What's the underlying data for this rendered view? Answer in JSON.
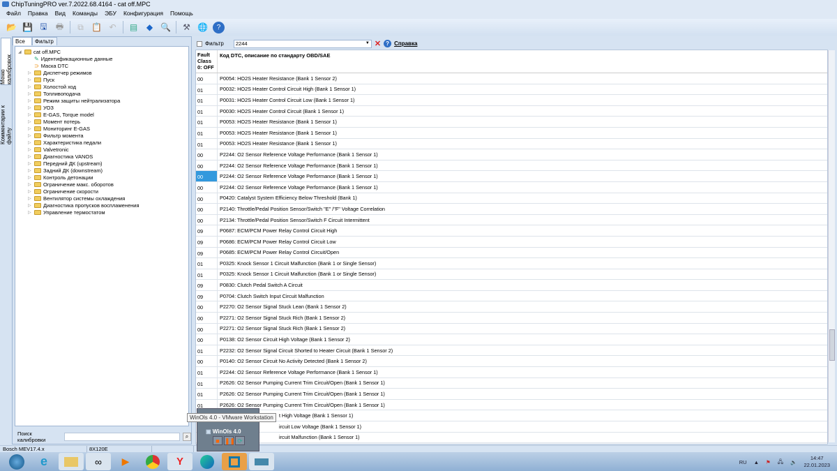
{
  "window": {
    "title": "ChipTuningPRO ver.7.2022.68.4164 - cat off.MPC"
  },
  "menu": [
    "Файл",
    "Правка",
    "Вид",
    "Команды",
    "ЭБУ",
    "Конфигурация",
    "Помощь"
  ],
  "vertical_tabs": [
    "Меню калибровок",
    "Комментарии к файлу"
  ],
  "left_tabs": [
    "Все",
    "Фильтр"
  ],
  "tree": {
    "root": "cat off.MPC",
    "items": [
      "Идентификационные данные",
      "Маска DTC",
      "Диспетчер режимов",
      "Пуск",
      "Холостой ход",
      "Топливоподача",
      "Режим защиты нейтрализатора",
      "УОЗ",
      "E-GAS, Torque model",
      "Момент потерь",
      "Мониторинг E-GAS",
      "Фильтр момента",
      "Характеристика педали",
      "Valvetronic",
      "Диагностика VANOS",
      "Передний ДК (upstream)",
      "Задний ДК (downstream)",
      "Контроль детонации",
      "Ограничение макс. оборотов",
      "Ограничение скорости",
      "Вентилятор системы охлаждения",
      "Диагностика пропусков воспламенения",
      "Управление термостатом"
    ]
  },
  "search": {
    "label": "Поиск калибровки",
    "value": ""
  },
  "filter": {
    "label": "Фильтр",
    "value": "2244",
    "help": "Справка"
  },
  "grid": {
    "col1": "Fault Class 0: OFF",
    "col2": "Код DTC, описание по стандарту OBD/SAE",
    "rows": [
      [
        "00",
        "P0054: HO2S Heater Resistance (Bank 1 Sensor 2)"
      ],
      [
        "01",
        "P0032: HO2S Heater Control Circuit High (Bank 1 Sensor 1)"
      ],
      [
        "01",
        "P0031: HO2S Heater Control Circuit Low (Bank 1 Sensor 1)"
      ],
      [
        "01",
        "P0030: HO2S Heater Control Circuit (Bank 1 Sensor 1)"
      ],
      [
        "01",
        "P0053: HO2S Heater Resistance (Bank 1 Sensor 1)"
      ],
      [
        "01",
        "P0053: HO2S Heater Resistance (Bank 1 Sensor 1)"
      ],
      [
        "01",
        "P0053: HO2S Heater Resistance (Bank 1 Sensor 1)"
      ],
      [
        "00",
        "P2244: O2 Sensor Reference Voltage Performance (Bank 1 Sensor 1)"
      ],
      [
        "00",
        "P2244: O2 Sensor Reference Voltage Performance (Bank 1 Sensor 1)"
      ],
      [
        "00",
        "P2244: O2 Sensor Reference Voltage Performance (Bank 1 Sensor 1)"
      ],
      [
        "00",
        "P2244: O2 Sensor Reference Voltage Performance (Bank 1 Sensor 1)"
      ],
      [
        "00",
        "P0420: Catalyst System Efficiency Below Threshold (Bank 1)"
      ],
      [
        "00",
        "P2140: Throttle/Pedal Position Sensor/Switch \"E\" /\"F\" Voltage Correlation"
      ],
      [
        "00",
        "P2134: Throttle/Pedal Position Sensor/Switch F Circuit Intermittent"
      ],
      [
        "09",
        "P0687: ECM/PCM Power Relay Control Circuit High"
      ],
      [
        "09",
        "P0686: ECM/PCM Power Relay Control Circuit Low"
      ],
      [
        "09",
        "P0685: ECM/PCM Power Relay Control Circuit/Open"
      ],
      [
        "01",
        "P0325: Knock Sensor 1 Circuit Malfunction (Bank 1 or Single Sensor)"
      ],
      [
        "01",
        "P0325: Knock Sensor 1 Circuit Malfunction (Bank 1 or Single Sensor)"
      ],
      [
        "09",
        "P0830: Clutch Pedal Switch A Circuit"
      ],
      [
        "09",
        "P0704: Clutch Switch Input Circuit Malfunction"
      ],
      [
        "00",
        "P2270: O2 Sensor Signal Stuck Lean (Bank 1 Sensor 2)"
      ],
      [
        "00",
        "P2271: O2 Sensor Signal Stuck Rich (Bank 1 Sensor 2)"
      ],
      [
        "00",
        "P2271: O2 Sensor Signal Stuck Rich (Bank 1 Sensor 2)"
      ],
      [
        "00",
        "P0138: O2 Sensor Circuit High Voltage (Bank 1 Sensor 2)"
      ],
      [
        "01",
        "P2232: O2 Sensor Signal Circuit Shorted to Heater Circuit (Bank 1 Sensor 2)"
      ],
      [
        "00",
        "P0140: O2 Sensor Circuit No Activity Detected (Bank 1 Sensor 2)"
      ],
      [
        "01",
        "P2244: O2 Sensor Reference Voltage Performance (Bank 1 Sensor 1)"
      ],
      [
        "01",
        "P2626: O2 Sensor Pumping Current Trim Circuit/Open (Bank 1 Sensor 1)"
      ],
      [
        "01",
        "P2626: O2 Sensor Pumping Current Trim Circuit/Open (Bank 1 Sensor 1)"
      ],
      [
        "01",
        "P2626: O2 Sensor Pumping Current Trim Circuit/Open (Bank 1 Sensor 1)"
      ],
      [
        "",
        "t High Voltage (Bank 1 Sensor 1)"
      ],
      [
        "",
        "ircuit Low Voltage (Bank 1 Sensor 1)"
      ],
      [
        "",
        "ircuit Malfunction (Bank 1 Sensor 1)"
      ]
    ]
  },
  "status": [
    "Bosch MEV17.4.x",
    "8X120E"
  ],
  "popup": {
    "tooltip": "WinOls 4.0 - VMware Workstation",
    "name": "WinOls 4.0"
  },
  "tray": {
    "lang": "RU",
    "time": "14:47",
    "date": "22.01.2023"
  }
}
